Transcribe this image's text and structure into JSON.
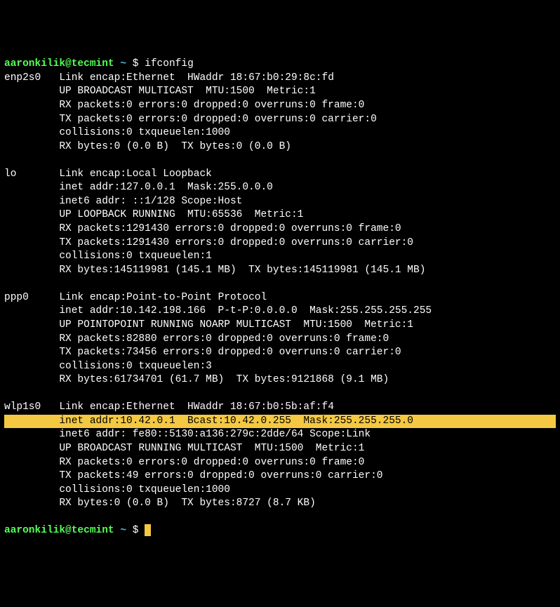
{
  "prompt": {
    "user": "aaronkilik@tecmint",
    "path": "~",
    "symbol": "$"
  },
  "command": "ifconfig",
  "interfaces": [
    {
      "name": "enp2s0",
      "lines": [
        "Link encap:Ethernet  HWaddr 18:67:b0:29:8c:fd",
        "UP BROADCAST MULTICAST  MTU:1500  Metric:1",
        "RX packets:0 errors:0 dropped:0 overruns:0 frame:0",
        "TX packets:0 errors:0 dropped:0 overruns:0 carrier:0",
        "collisions:0 txqueuelen:1000",
        "RX bytes:0 (0.0 B)  TX bytes:0 (0.0 B)"
      ]
    },
    {
      "name": "lo",
      "lines": [
        "Link encap:Local Loopback",
        "inet addr:127.0.0.1  Mask:255.0.0.0",
        "inet6 addr: ::1/128 Scope:Host",
        "UP LOOPBACK RUNNING  MTU:65536  Metric:1",
        "RX packets:1291430 errors:0 dropped:0 overruns:0 frame:0",
        "TX packets:1291430 errors:0 dropped:0 overruns:0 carrier:0",
        "collisions:0 txqueuelen:1",
        "RX bytes:145119981 (145.1 MB)  TX bytes:145119981 (145.1 MB)"
      ]
    },
    {
      "name": "ppp0",
      "lines": [
        "Link encap:Point-to-Point Protocol",
        "inet addr:10.142.198.166  P-t-P:0.0.0.0  Mask:255.255.255.255",
        "UP POINTOPOINT RUNNING NOARP MULTICAST  MTU:1500  Metric:1",
        "RX packets:82880 errors:0 dropped:0 overruns:0 frame:0",
        "TX packets:73456 errors:0 dropped:0 overruns:0 carrier:0",
        "collisions:0 txqueuelen:3",
        "RX bytes:61734701 (61.7 MB)  TX bytes:9121868 (9.1 MB)"
      ]
    },
    {
      "name": "wlp1s0",
      "lines": [
        "Link encap:Ethernet  HWaddr 18:67:b0:5b:af:f4",
        "inet addr:10.42.0.1  Bcast:10.42.0.255  Mask:255.255.255.0",
        "inet6 addr: fe80::5130:a136:279c:2dde/64 Scope:Link",
        "UP BROADCAST RUNNING MULTICAST  MTU:1500  Metric:1",
        "RX packets:0 errors:0 dropped:0 overruns:0 frame:0",
        "TX packets:49 errors:0 dropped:0 overruns:0 carrier:0",
        "collisions:0 txqueuelen:1000",
        "RX bytes:0 (0.0 B)  TX bytes:8727 (8.7 KB)"
      ],
      "highlight_index": 1
    }
  ],
  "indent_width": 9
}
